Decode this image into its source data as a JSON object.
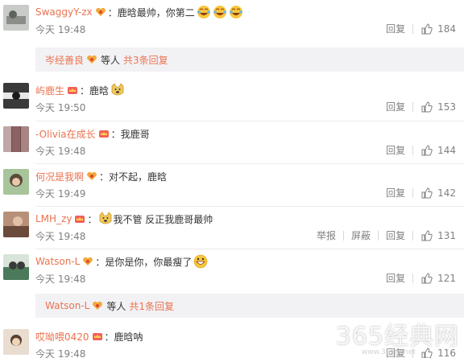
{
  "comments": [
    {
      "user": "SwaggyY-zx",
      "badge": "heart",
      "text": "：鹿晗最帅，你第二",
      "emojis": [
        "laugh-cry",
        "laugh-cry",
        "laugh-cry"
      ],
      "time": "今天 19:48",
      "reply": "回复",
      "likes": "184"
    },
    {
      "user": "屿鹿生",
      "badge": "crown",
      "text": "：鹿晗",
      "emojis": [
        "doge"
      ],
      "time": "今天 19:50",
      "reply": "回复",
      "likes": "153"
    },
    {
      "user": "-Olivia在成长",
      "badge": "crown",
      "text": "：我鹿哥",
      "emojis": [],
      "time": "今天 19:48",
      "reply": "回复",
      "likes": "144"
    },
    {
      "user": "何况是我啊",
      "badge": "heart",
      "text": "：对不起，鹿晗",
      "emojis": [],
      "time": "今天 19:49",
      "reply": "回复",
      "likes": "142"
    },
    {
      "user": "LMH_zy",
      "badge": "crown",
      "text": "我不管 反正我鹿哥最帅",
      "emojis": [
        "doge"
      ],
      "time": "今天 19:48",
      "report": "举报",
      "block": "屏蔽",
      "reply": "回复",
      "likes": "131"
    },
    {
      "user": "Watson-L",
      "badge": "heart",
      "text": "：是你是你，你最瘦了",
      "emojis": [
        "grin"
      ],
      "time": "今天 19:48",
      "reply": "回复",
      "likes": "121"
    },
    {
      "user": "哎呦喂0420",
      "badge": "crown",
      "text": "：鹿晗呐",
      "emojis": [],
      "time": "今天 19:48",
      "reply": "回复",
      "likes": "116"
    }
  ],
  "reply_bars": [
    {
      "user": "岑经善良",
      "text": "等人",
      "count": "共3条回复"
    },
    {
      "user": "Watson-L",
      "text": "等人",
      "count": "共1条回复"
    }
  ],
  "watermark": {
    "main": "365经典网",
    "sub": "www.365jd.net"
  },
  "colors": {
    "username": "#eb7350",
    "time": "#808080",
    "reply_bg": "#f2f2f5"
  }
}
